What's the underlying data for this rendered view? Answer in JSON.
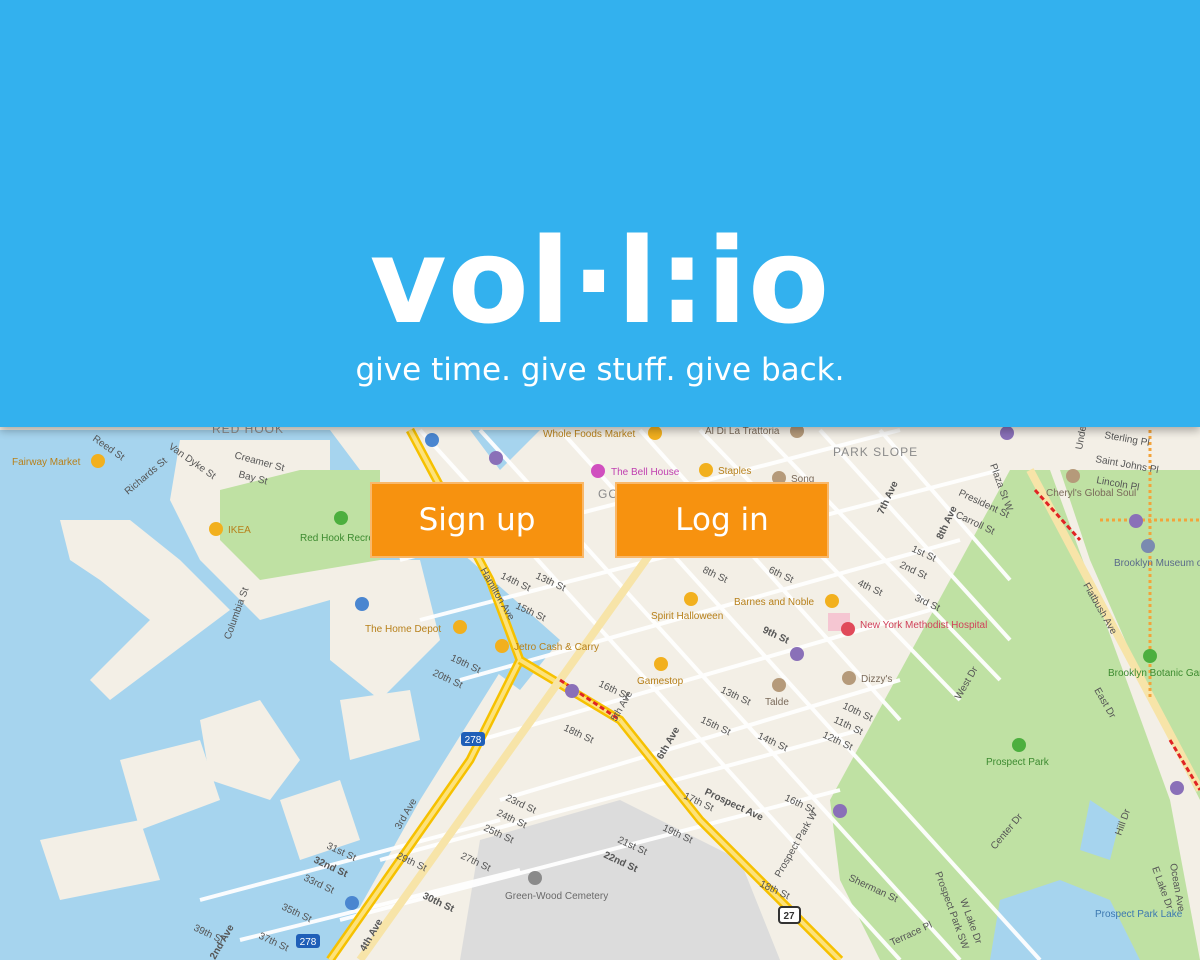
{
  "brand": {
    "logo": "vol·l:io",
    "tagline": "give time. give stuff. give back.",
    "hero_color": "#33b1ee",
    "button_color": "#f7920f"
  },
  "actions": {
    "signup_label": "Sign up",
    "login_label": "Log in"
  },
  "map": {
    "neighborhoods": [
      "RED HOOK",
      "PARK SLOPE",
      "GOWANUS"
    ],
    "places": [
      {
        "name": "Fairway Market",
        "icon": "shopping-bag-icon"
      },
      {
        "name": "IKEA",
        "icon": "shopping-bag-icon"
      },
      {
        "name": "Red Hook Recreational Area",
        "icon": "park-icon"
      },
      {
        "name": "The Home Depot",
        "icon": "shopping-bag-icon"
      },
      {
        "name": "Whole Foods Market",
        "icon": "shopping-bag-icon"
      },
      {
        "name": "Al Di La Trattoria",
        "icon": "restaurant-icon"
      },
      {
        "name": "The Bell House",
        "icon": "bar-icon"
      },
      {
        "name": "Staples",
        "icon": "shopping-bag-icon"
      },
      {
        "name": "Song",
        "icon": "restaurant-icon"
      },
      {
        "name": "Spirit Halloween",
        "icon": "shopping-bag-icon"
      },
      {
        "name": "Barnes and Noble",
        "icon": "shopping-bag-icon"
      },
      {
        "name": "New York Methodist Hospital",
        "icon": "hospital-icon"
      },
      {
        "name": "Jetro Cash & Carry",
        "icon": "shopping-cart-icon"
      },
      {
        "name": "Gamestop",
        "icon": "shopping-bag-icon"
      },
      {
        "name": "Dizzy's",
        "icon": "restaurant-icon"
      },
      {
        "name": "Talde",
        "icon": "restaurant-icon"
      },
      {
        "name": "Cheryl's Global Soul",
        "icon": "restaurant-icon"
      },
      {
        "name": "Brooklyn Museum of Art",
        "icon": "museum-icon"
      },
      {
        "name": "Brooklyn Botanic Gardens",
        "icon": "park-icon"
      },
      {
        "name": "Prospect Park",
        "icon": "park-icon"
      },
      {
        "name": "Green-Wood Cemetery",
        "icon": "cemetery-icon"
      },
      {
        "name": "Prospect Park Lake",
        "icon": "water-icon"
      }
    ],
    "streets": [
      "Reed St",
      "Van Dyke St",
      "Richards St",
      "Creamer St",
      "Bay St",
      "Columbia St",
      "Hamilton Ave",
      "14th St",
      "13th St",
      "15th St",
      "19th St",
      "20th St",
      "16th St",
      "18th St",
      "5th Ave",
      "6th Ave",
      "Prospect Ave",
      "17th St",
      "23rd St",
      "24th St",
      "25th St",
      "29th St",
      "27th St",
      "31st St",
      "32nd St",
      "33rd St",
      "35th St",
      "37th St",
      "39th St",
      "30th St",
      "3rd Ave",
      "4th Ave",
      "2nd Ave",
      "21st St",
      "22nd St",
      "19th St",
      "18th St",
      "Prospect Park W",
      "Prospect Park SW",
      "16th St",
      "Sherman St",
      "Terrace Pl",
      "7th Ave",
      "8th Ave",
      "President St",
      "Carroll St",
      "1st St",
      "2nd St",
      "3rd St",
      "4th St",
      "6th St",
      "8th St",
      "9th St",
      "10th St",
      "11th St",
      "12th St",
      "13th St",
      "14th St",
      "15th St",
      "Plaza St W",
      "Flatbush Ave",
      "Sterling Pl",
      "Saint Johns Pl",
      "Lincoln Pl",
      "Underhill Ave",
      "West Dr",
      "East Dr",
      "Center Dr",
      "Hill Dr",
      "W Lake Dr",
      "E Lake Dr",
      "Ocean Ave"
    ],
    "shields": [
      "278",
      "278",
      "27"
    ]
  }
}
